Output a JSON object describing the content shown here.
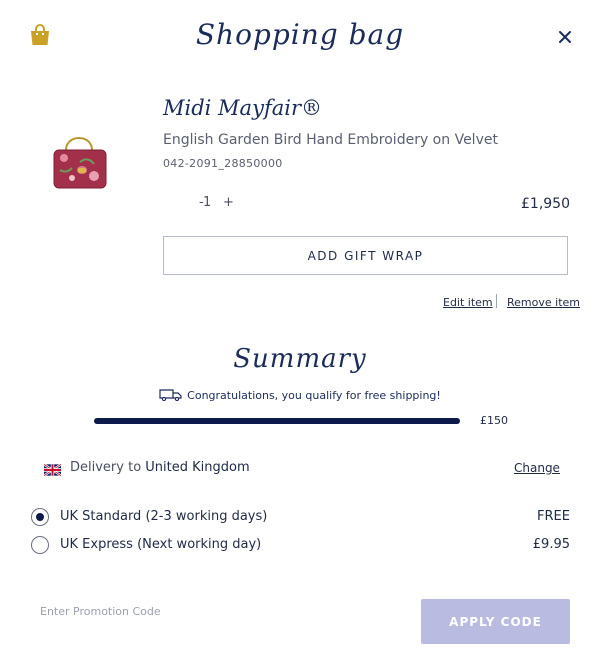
{
  "header": {
    "title": "Shopping bag",
    "bag_icon": "shopping-bag-icon",
    "close_icon": "close-icon"
  },
  "cart": {
    "item": {
      "name": "Midi Mayfair®",
      "description": "English Garden Bird Hand Embroidery on Velvet",
      "sku": "042-2091_28850000",
      "quantity": "1",
      "qty_minus": "-",
      "qty_plus": "+",
      "price": "£1,950"
    },
    "gift_wrap_label": "ADD GIFT WRAP",
    "edit_label": "Edit item",
    "remove_label": "Remove item"
  },
  "summary": {
    "title": "Summary",
    "free_shipping_message": "Congratulations, you qualify for free shipping!",
    "free_shipping_threshold": "£150",
    "progress_fraction": 1.0,
    "delivery_prefix": "Delivery to",
    "delivery_country": "United Kingdom",
    "change_label": "Change",
    "shipping_options": [
      {
        "label": "UK Standard (2-3 working days)",
        "price": "FREE",
        "selected": true
      },
      {
        "label": "UK Express (Next working day)",
        "price": "£9.95",
        "selected": false
      }
    ]
  },
  "promo": {
    "placeholder": "Enter Promotion Code",
    "apply_label": "APPLY CODE"
  },
  "colors": {
    "brand_navy": "#1b2c5a",
    "progress": "#0b1a4a",
    "apply_button": "#b9bbe0",
    "bag_icon": "#c9a227"
  }
}
